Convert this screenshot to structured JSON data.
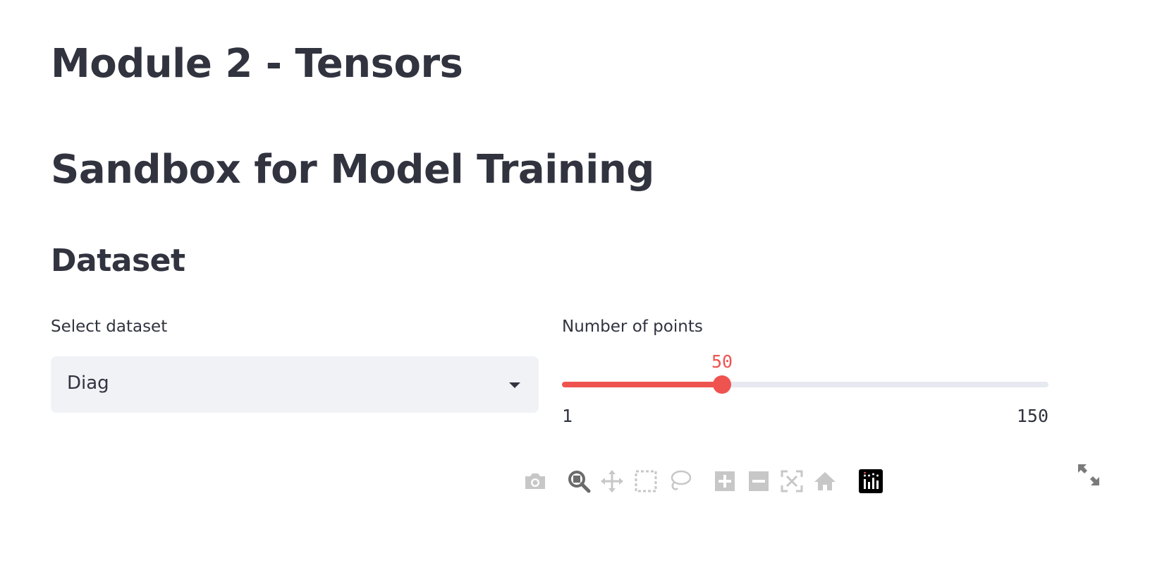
{
  "header": {
    "title": "Module 2 - Tensors",
    "subtitle": "Sandbox for Model Training"
  },
  "dataset_section": {
    "heading": "Dataset",
    "select": {
      "label": "Select dataset",
      "value": "Diag"
    },
    "slider": {
      "label": "Number of points",
      "min": 1,
      "max": 150,
      "value": 50,
      "min_label": "1",
      "max_label": "150",
      "value_label": "50",
      "accent_color": "#ef5350"
    }
  },
  "plot_toolbar": {
    "icons": [
      "camera-icon",
      "zoom-icon",
      "pan-icon",
      "box-select-icon",
      "lasso-select-icon",
      "zoom-in-icon",
      "zoom-out-icon",
      "autoscale-icon",
      "reset-axes-icon",
      "plotly-logo-icon"
    ],
    "active": "zoom-icon",
    "expand_icon": "fullscreen-icon"
  }
}
